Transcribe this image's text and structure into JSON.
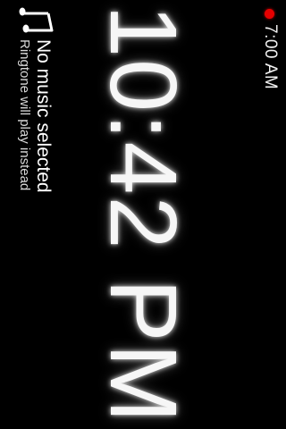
{
  "alarm": {
    "time": "7:00 AM",
    "indicator_color": "#e60000"
  },
  "clock": {
    "time": "10:42 PM"
  },
  "music": {
    "icon": "music-note-icon",
    "title": "No music selected",
    "subtitle": "Ringtone will play instead"
  },
  "colors": {
    "background": "#000000",
    "text": "#ffffff"
  }
}
